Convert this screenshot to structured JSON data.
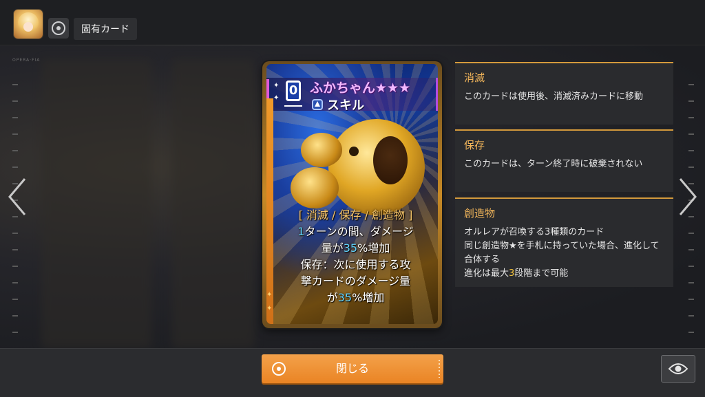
{
  "header": {
    "title": "固有カード",
    "avatar_icon": "character-portrait",
    "target_icon": "target-icon"
  },
  "background": {
    "tiny_label": "OPERA·FIA"
  },
  "card": {
    "cost": "0",
    "name": "ふかちゃん★★★",
    "type_label": "スキル",
    "type_icon": "skill-triangle-icon",
    "keywords": "[ 消滅 / 保存 / 創造物 ]",
    "desc_line1_num": "1",
    "desc_line1_text": "ターンの間、ダメージ",
    "desc_line2_pre": "量が",
    "desc_line2_num": "35",
    "desc_line2_post": "%増加",
    "desc_line3": "保存：次に使用する攻",
    "desc_line4": "撃カードのダメージ量",
    "desc_line5_pre": "が",
    "desc_line5_num": "35",
    "desc_line5_post": "%増加",
    "colors": {
      "name": "#f0b8ff",
      "keyword": "#f6c56a",
      "number": "#5fd3ff"
    }
  },
  "info_panels": {
    "p1": {
      "title": "消滅",
      "text": "このカードは使用後、消滅済みカードに移動"
    },
    "p2": {
      "title": "保存",
      "text": "このカードは、ターン終了時に破棄されない"
    },
    "p3": {
      "title": "創造物",
      "line1": "オルレアが召喚する3種類のカード",
      "line2": "同じ創造物★を手札に持っていた場合、進化して合体する",
      "line3_pre": "進化は最大",
      "line3_num": "3",
      "line3_post": "段階まで可能"
    },
    "accent": "#d49a3c"
  },
  "footer": {
    "close_label": "閉じる",
    "eye_icon": "eye-icon",
    "accent": "#ea8424"
  },
  "nav": {
    "prev_icon": "chevron-left-icon",
    "next_icon": "chevron-right-icon"
  }
}
